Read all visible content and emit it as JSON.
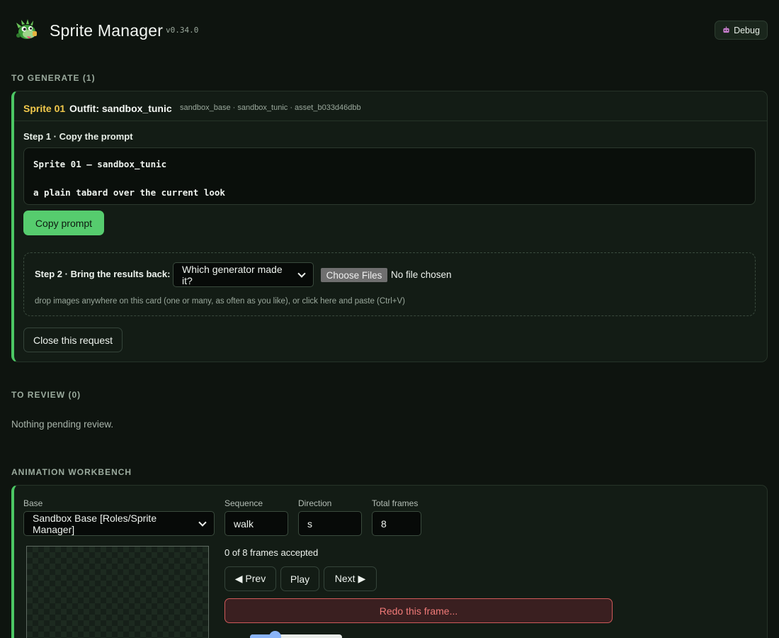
{
  "app": {
    "title": "Sprite Manager",
    "version": "v0.34.0",
    "debug_label": "Debug"
  },
  "sections": {
    "to_generate": "TO GENERATE (1)",
    "to_review": "TO REVIEW (0)",
    "workbench": "ANIMATION WORKBENCH"
  },
  "request": {
    "sprite_id": "Sprite 01",
    "outfit": "Outfit: sandbox_tunic",
    "meta": "sandbox_base · sandbox_tunic · asset_b033d46dbb",
    "step1_label": "Step 1 · Copy the prompt",
    "prompt_line1": "Sprite 01 — sandbox_tunic",
    "prompt_line2": "a plain tabard over the current look",
    "copy_label": "Copy prompt",
    "step2_label": "Step 2 · Bring the results back:",
    "generator_select": "Which generator made it?",
    "choose_files_label": "Choose Files",
    "no_file_label": "No file chosen",
    "drop_hint": "drop images anywhere on this card (one or many, as often as you like), or click here and paste (Ctrl+V)",
    "close_label": "Close this request"
  },
  "review": {
    "empty_text": "Nothing pending review."
  },
  "workbench": {
    "base_label": "Base",
    "base_value": "Sandbox Base [Roles/Sprite Manager]",
    "sequence_label": "Sequence",
    "sequence_value": "walk",
    "direction_label": "Direction",
    "direction_value": "s",
    "total_frames_label": "Total frames",
    "total_frames_value": "8",
    "frames_status": "0 of 8 frames accepted",
    "prev_label": "◀ Prev",
    "play_label": "Play",
    "next_label": "Next ▶",
    "redo_label": "Redo this frame...",
    "slider_level": 0.25
  },
  "colors": {
    "accent": "#4cc764",
    "sprite_id": "#f2c94c",
    "danger": "#f07a78",
    "slider": "#8ab4f8"
  },
  "icons": [
    "dragon-logo-icon",
    "robot-icon",
    "chevron-down-icon"
  ]
}
